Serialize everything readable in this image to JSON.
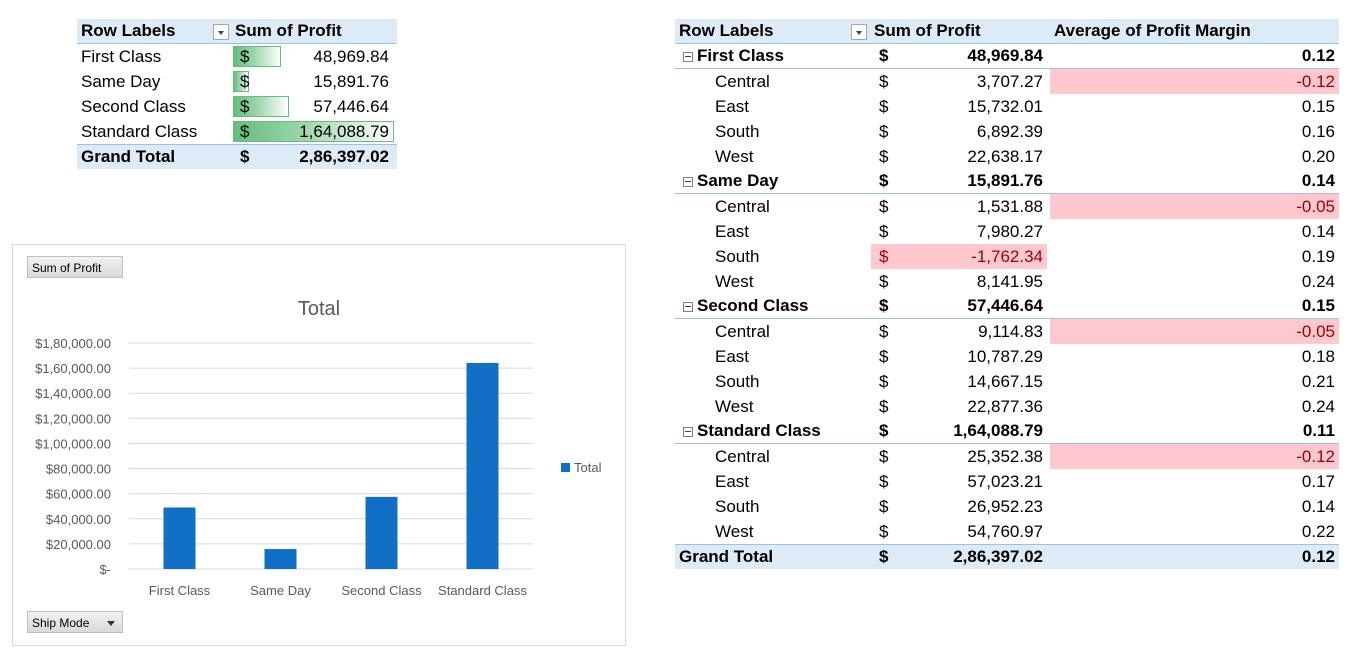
{
  "left_pivot": {
    "header": {
      "row_labels": "Row Labels",
      "value_label": "Sum of Profit"
    },
    "currency": "$",
    "rows": [
      {
        "label": "First Class",
        "value": "48,969.84",
        "bar": 0.2984
      },
      {
        "label": "Same Day",
        "value": "15,891.76",
        "bar": 0.0968
      },
      {
        "label": "Second Class",
        "value": "57,446.64",
        "bar": 0.3501
      },
      {
        "label": "Standard Class",
        "value": "1,64,088.79",
        "bar": 1.0
      }
    ],
    "total": {
      "label": "Grand Total",
      "currency": "$",
      "value": "2,86,397.02"
    }
  },
  "chart": {
    "field_button": "Sum of Profit",
    "axis_button": "Ship Mode",
    "chart_data": {
      "type": "bar",
      "title": "Total",
      "categories": [
        "First Class",
        "Same Day",
        "Second Class",
        "Standard Class"
      ],
      "series": [
        {
          "name": "Total",
          "values": [
            48969.84,
            15891.76,
            57446.64,
            164088.79
          ]
        }
      ],
      "ylim": [
        0,
        180000
      ],
      "yticks": [
        "$-",
        "$20,000.00",
        "$40,000.00",
        "$60,000.00",
        "$80,000.00",
        "$1,00,000.00",
        "$1,20,000.00",
        "$1,40,000.00",
        "$1,60,000.00",
        "$1,80,000.00"
      ],
      "grid": true,
      "legend": "right",
      "color": "#1170c6"
    }
  },
  "right_pivot": {
    "header": {
      "row_labels": "Row Labels",
      "profit": "Sum of Profit",
      "margin": "Average of Profit Margin"
    },
    "currency": "$",
    "groups": [
      {
        "label": "First Class",
        "profit": "48,969.84",
        "margin": "0.12",
        "children": [
          {
            "label": "Central",
            "profit": "3,707.27",
            "margin": "-0.12",
            "neg_margin": true,
            "neg_profit": false
          },
          {
            "label": "East",
            "profit": "15,732.01",
            "margin": "0.15",
            "neg_margin": false,
            "neg_profit": false
          },
          {
            "label": "South",
            "profit": "6,892.39",
            "margin": "0.16",
            "neg_margin": false,
            "neg_profit": false
          },
          {
            "label": "West",
            "profit": "22,638.17",
            "margin": "0.20",
            "neg_margin": false,
            "neg_profit": false
          }
        ]
      },
      {
        "label": "Same Day",
        "profit": "15,891.76",
        "margin": "0.14",
        "children": [
          {
            "label": "Central",
            "profit": "1,531.88",
            "margin": "-0.05",
            "neg_margin": true,
            "neg_profit": false
          },
          {
            "label": "East",
            "profit": "7,980.27",
            "margin": "0.14",
            "neg_margin": false,
            "neg_profit": false
          },
          {
            "label": "South",
            "profit": "-1,762.34",
            "margin": "0.19",
            "neg_margin": false,
            "neg_profit": true
          },
          {
            "label": "West",
            "profit": "8,141.95",
            "margin": "0.24",
            "neg_margin": false,
            "neg_profit": false
          }
        ]
      },
      {
        "label": "Second Class",
        "profit": "57,446.64",
        "margin": "0.15",
        "children": [
          {
            "label": "Central",
            "profit": "9,114.83",
            "margin": "-0.05",
            "neg_margin": true,
            "neg_profit": false
          },
          {
            "label": "East",
            "profit": "10,787.29",
            "margin": "0.18",
            "neg_margin": false,
            "neg_profit": false
          },
          {
            "label": "South",
            "profit": "14,667.15",
            "margin": "0.21",
            "neg_margin": false,
            "neg_profit": false
          },
          {
            "label": "West",
            "profit": "22,877.36",
            "margin": "0.24",
            "neg_margin": false,
            "neg_profit": false
          }
        ]
      },
      {
        "label": "Standard Class",
        "profit": "1,64,088.79",
        "margin": "0.11",
        "children": [
          {
            "label": "Central",
            "profit": "25,352.38",
            "margin": "-0.12",
            "neg_margin": true,
            "neg_profit": false
          },
          {
            "label": "East",
            "profit": "57,023.21",
            "margin": "0.17",
            "neg_margin": false,
            "neg_profit": false
          },
          {
            "label": "South",
            "profit": "26,952.23",
            "margin": "0.14",
            "neg_margin": false,
            "neg_profit": false
          },
          {
            "label": "West",
            "profit": "54,760.97",
            "margin": "0.22",
            "neg_margin": false,
            "neg_profit": false
          }
        ]
      }
    ],
    "total": {
      "label": "Grand Total",
      "profit": "2,86,397.02",
      "margin": "0.12"
    }
  }
}
